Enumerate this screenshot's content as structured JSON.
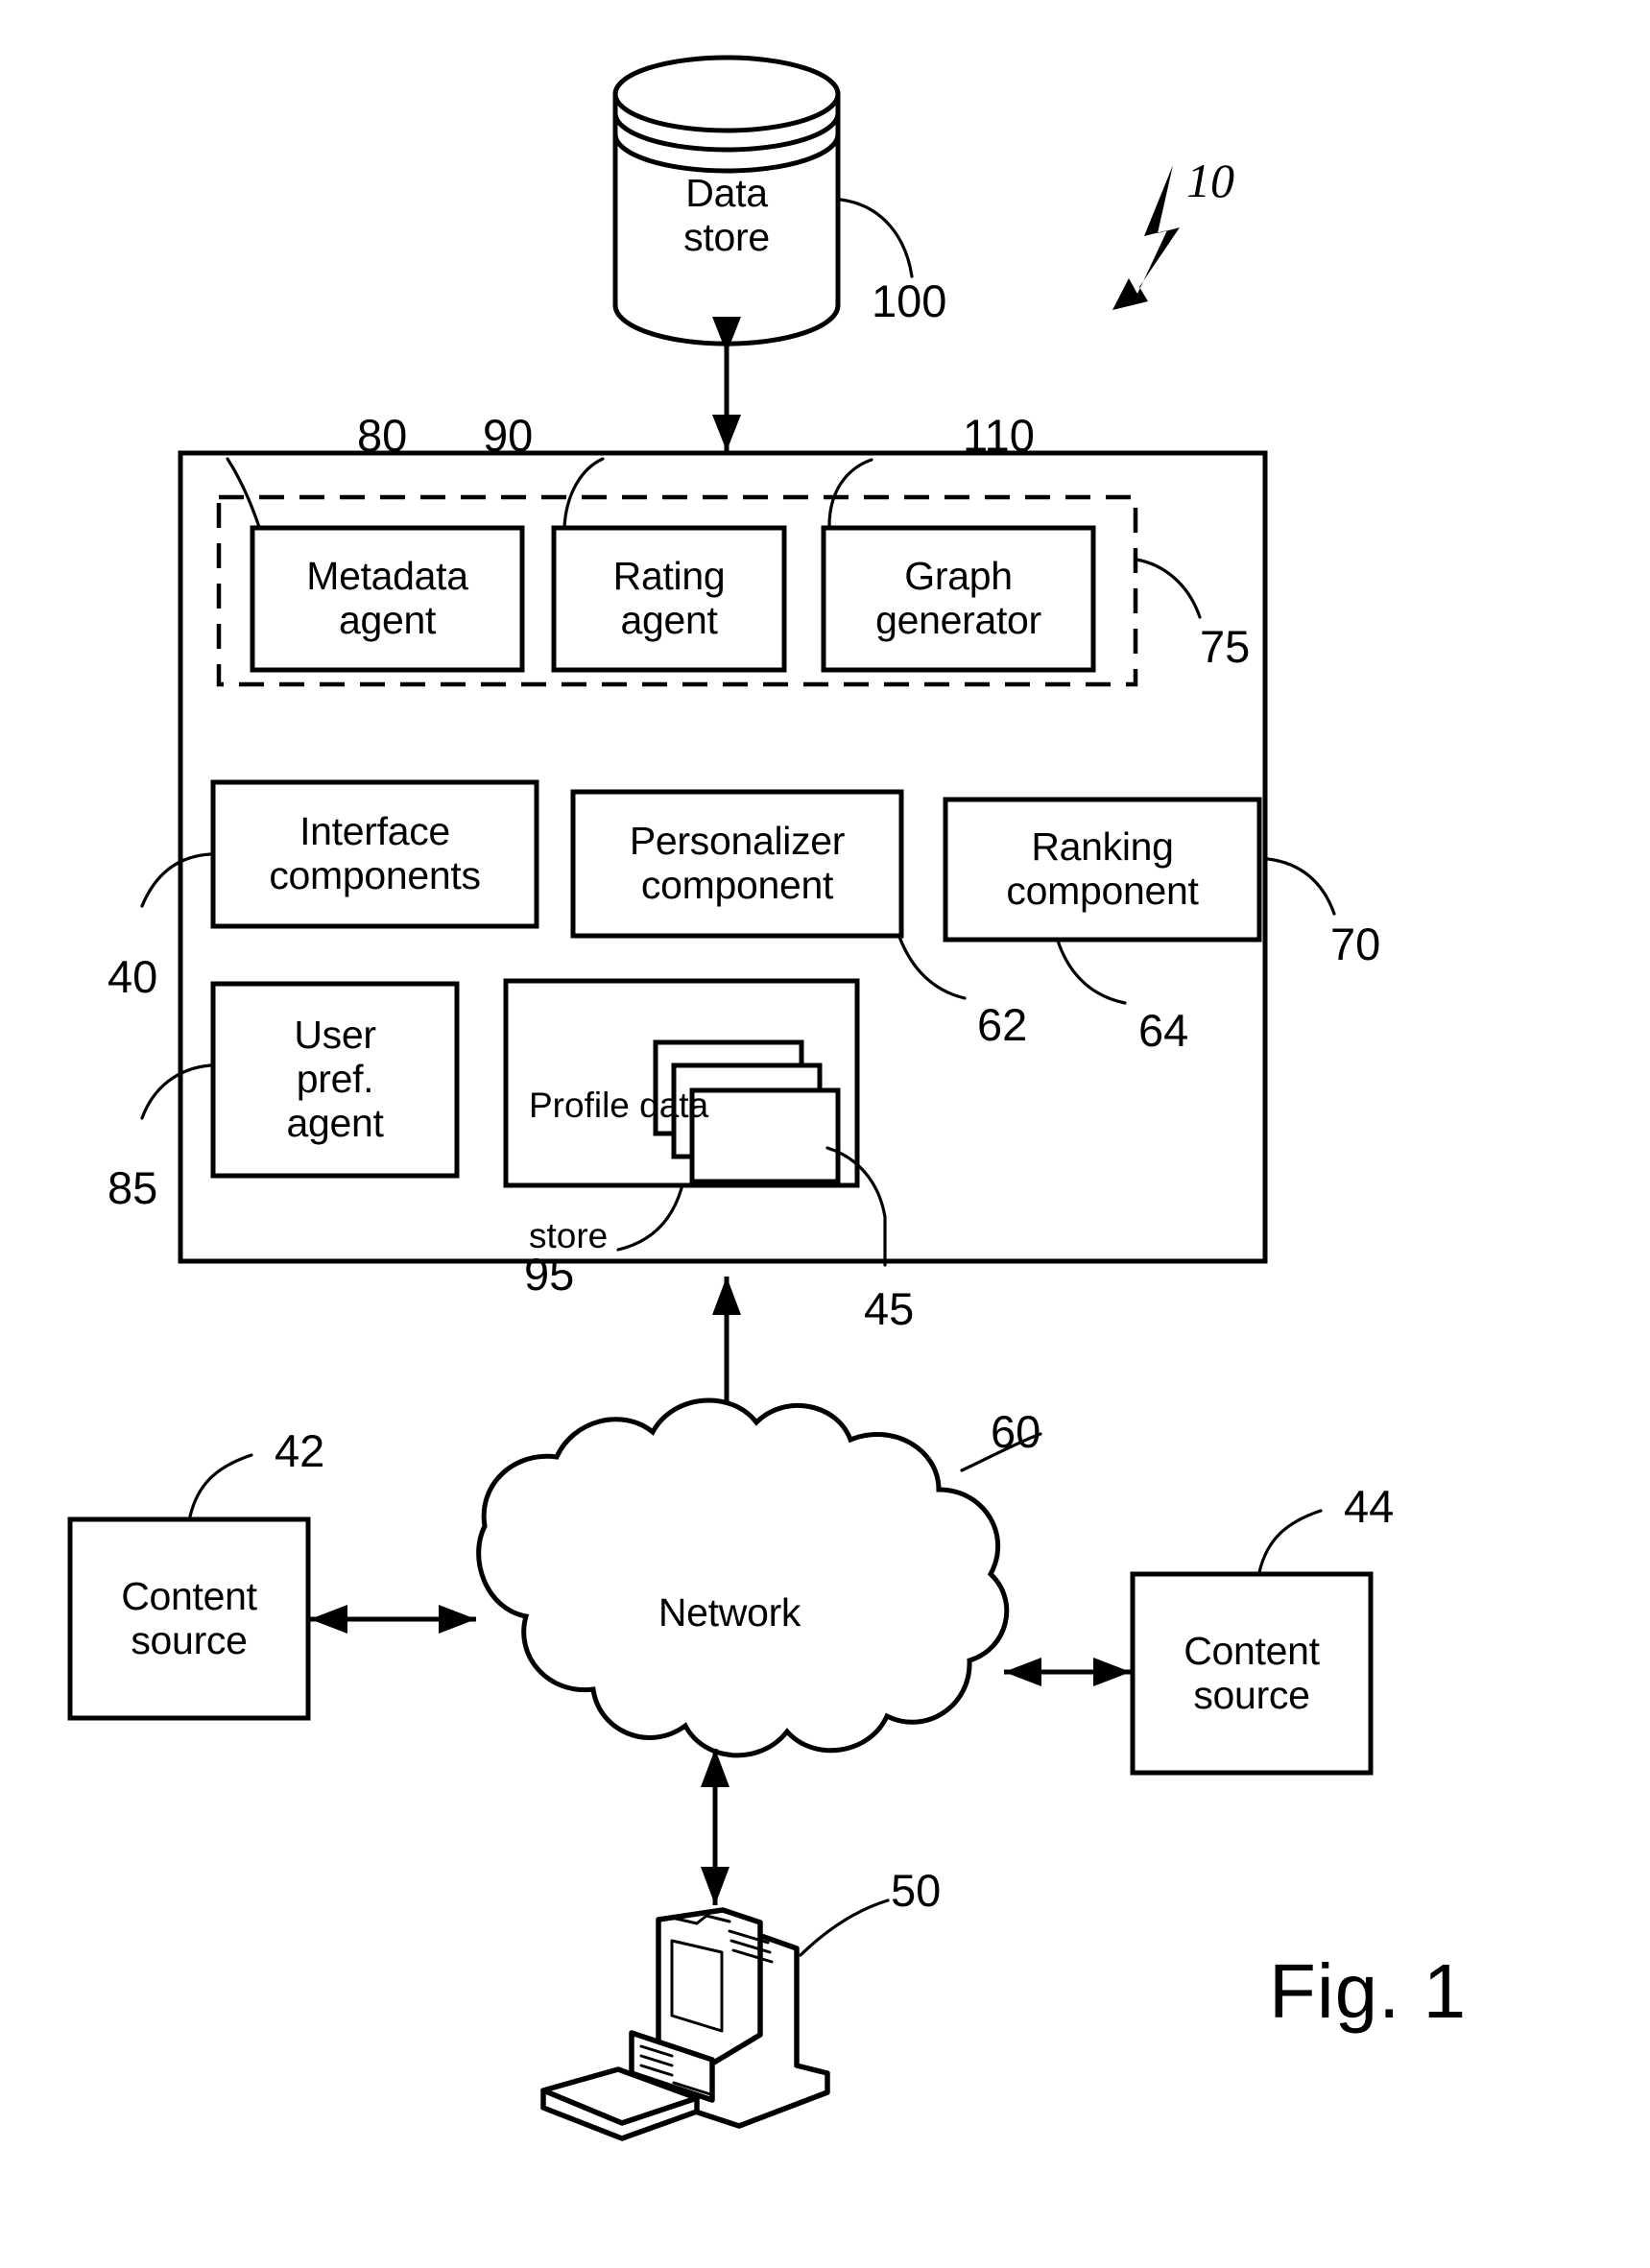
{
  "figure": {
    "caption": "Fig. 1",
    "system_ref": "10"
  },
  "nodes": {
    "data_store": {
      "line1": "Data",
      "line2": "store",
      "ref": "100"
    },
    "metadata_agent": {
      "line1": "Metadata",
      "line2": "agent",
      "ref": "80"
    },
    "rating_agent": {
      "line1": "Rating",
      "line2": "agent",
      "ref": "90"
    },
    "graph_generator": {
      "line1": "Graph",
      "line2": "generator",
      "ref": "110"
    },
    "agent_group": {
      "ref": "75"
    },
    "interface_components": {
      "line1": "Interface",
      "line2": "components",
      "ref": "40"
    },
    "personalizer_component": {
      "line1": "Personalizer",
      "line2": "component",
      "ref": "62"
    },
    "ranking_component": {
      "line1": "Ranking",
      "line2": "component",
      "ref": "64"
    },
    "user_pref_agent": {
      "line1": "User",
      "line2": "pref.",
      "line3": "agent",
      "ref": "85"
    },
    "profile_data_store": {
      "line1": "Profile data",
      "line2": "store",
      "ref": "95"
    },
    "system_container": {
      "ref": "45",
      "right_ref": "70"
    },
    "network": {
      "label": "Network",
      "ref": "60"
    },
    "content_source_left": {
      "line1": "Content",
      "line2": "source",
      "ref": "42"
    },
    "content_source_right": {
      "line1": "Content",
      "line2": "source",
      "ref": "44"
    },
    "client_computer": {
      "ref": "50"
    }
  },
  "colors": {
    "ink": "#000000",
    "paper": "#ffffff"
  }
}
